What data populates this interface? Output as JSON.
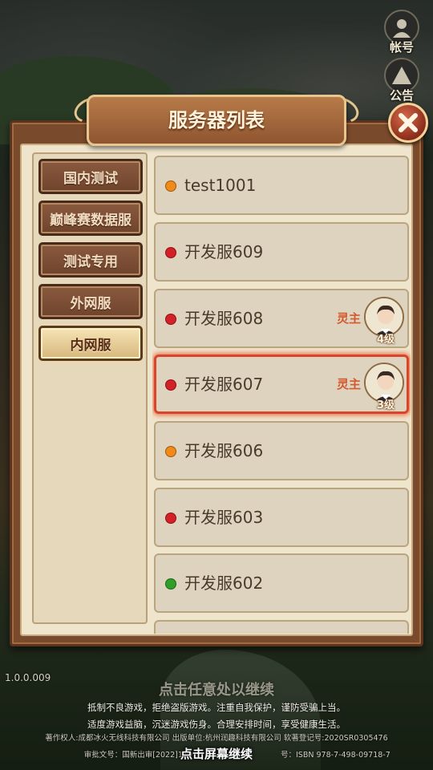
{
  "side_buttons": {
    "account_label": "帐号",
    "notice_label": "公告"
  },
  "panel": {
    "title": "服务器列表"
  },
  "tabs": [
    {
      "label": "国内测试",
      "active": false
    },
    {
      "label": "巅峰赛数据服",
      "active": false
    },
    {
      "label": "测试专用",
      "active": false
    },
    {
      "label": "外网服",
      "active": false
    },
    {
      "label": "内网服",
      "active": true
    }
  ],
  "servers": [
    {
      "name": "test1001",
      "status_color": "#f28a1a",
      "selected": false
    },
    {
      "name": "开发服609",
      "status_color": "#d42027",
      "selected": false
    },
    {
      "name": "开发服608",
      "status_color": "#d42027",
      "selected": false,
      "role": "灵主",
      "level": "4级"
    },
    {
      "name": "开发服607",
      "status_color": "#d42027",
      "selected": true,
      "role": "灵主",
      "level": "3级"
    },
    {
      "name": "开发服606",
      "status_color": "#f28a1a",
      "selected": false
    },
    {
      "name": "开发服603",
      "status_color": "#d42027",
      "selected": false
    },
    {
      "name": "开发服602",
      "status_color": "#2f9e2a",
      "selected": false
    }
  ],
  "footer": {
    "version": "1.0.0.009",
    "tap_anywhere": "点击任意处以继续",
    "health_notice_1": "抵制不良游戏，拒绝盗版游戏。注重自我保护，谨防受骗上当。",
    "health_notice_2": "适度游戏益脑，沉迷游戏伤身。合理安排时间，享受健康生活。",
    "copyright": "著作权人:成都冰火无线科技有限公司 出版单位:杭州润趣科技有限公司 软著登记号:2020SR0305476",
    "approval": "审批文号：国新出审[2022]119",
    "isbn": "号：ISBN 978-7-498-09718-7",
    "tap_screen": "点击屏幕继续"
  }
}
